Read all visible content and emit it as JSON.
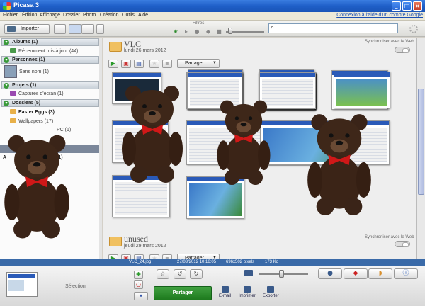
{
  "window": {
    "title": "Picasa 3"
  },
  "menu": {
    "items": [
      "Fichier",
      "Édition",
      "Affichage",
      "Dossier",
      "Photo",
      "Création",
      "Outils",
      "Aide"
    ],
    "signin": "Connexion à l'aide d'un compte Google"
  },
  "toolbar": {
    "import_label": "Importer",
    "filters_label": "Filtres",
    "search_placeholder": ""
  },
  "left": {
    "sections": {
      "albums": "Albums (1)",
      "persons": "Personnes (1)",
      "projects": "Projets (1)",
      "folders": "Dossiers (5)"
    },
    "items": {
      "recent": "Récemment mis à jour (44)",
      "no_name": "Sans nom (1)",
      "captures": "Captures d'écran (1)",
      "easter": "Easter Eggs (3)",
      "wallpapers": "Wallpapers (17)",
      "partial_folder": "PC (1)",
      "partial_a": "A",
      "partial_count": "(1)"
    }
  },
  "albums": [
    {
      "name": "VLC",
      "date": "lundi 26 mars 2012",
      "sync": "Synchroniser avec le Web",
      "share": "Partager"
    },
    {
      "name": "unused",
      "date": "jeudi 29 mars 2012",
      "sync": "Synchroniser avec le Web",
      "share": "Partager"
    }
  ],
  "status": {
    "filename": "VLC_24.jpg",
    "datetime": "27/03/2012 10:16:05",
    "dimensions": "696x502 pixels",
    "size": "173 Ko"
  },
  "tray": {
    "selection_label": "Sélection",
    "share_label": "Partager",
    "email_label": "E-mail",
    "print_label": "Imprimer",
    "export_label": "Exporter"
  },
  "icons": [
    "app-icon",
    "import-icon",
    "star-icon",
    "person-icon",
    "pin-icon",
    "info-icon",
    "search-icon",
    "folder-icon",
    "play-icon",
    "rotate-left-icon",
    "rotate-right-icon",
    "zoom-icon"
  ]
}
